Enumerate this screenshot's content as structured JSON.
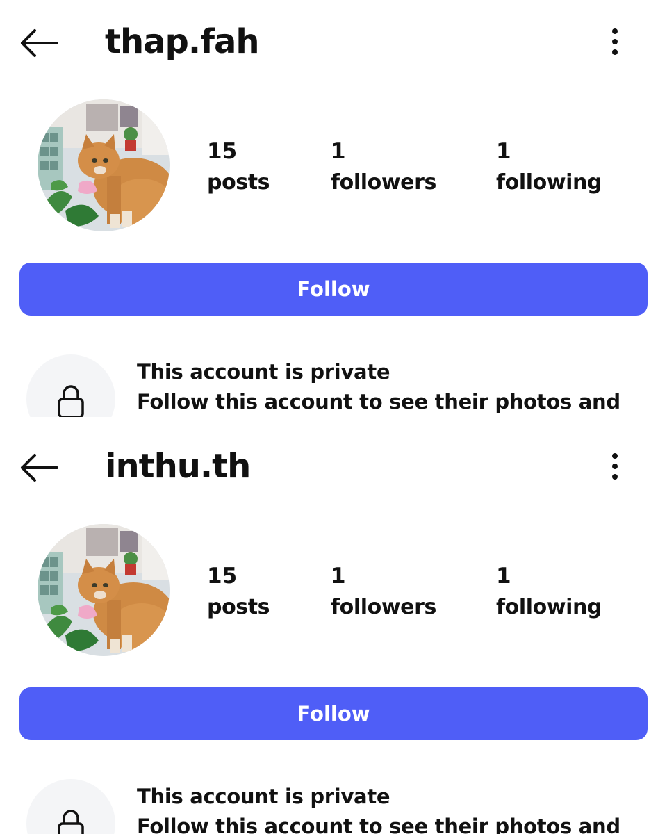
{
  "profiles": [
    {
      "username": "thap.fah",
      "back_icon": "arrow-left-icon",
      "more_icon": "more-vertical-icon",
      "avatar_description_icon": "cat-photo",
      "stats": {
        "posts_count": "15",
        "posts_label": "posts",
        "followers_count": "1",
        "followers_label": "followers",
        "following_count": "1",
        "following_label": "following"
      },
      "follow_label": "Follow",
      "private_title": "This account is private",
      "private_desc": "Follow this account to see their photos and",
      "lock_icon": "lock-icon"
    },
    {
      "username": "inthu.th",
      "back_icon": "arrow-left-icon",
      "more_icon": "more-vertical-icon",
      "avatar_description_icon": "cat-photo",
      "stats": {
        "posts_count": "15",
        "posts_label": "posts",
        "followers_count": "1",
        "followers_label": "followers",
        "following_count": "1",
        "following_label": "following"
      },
      "follow_label": "Follow",
      "private_title": "This account is private",
      "private_desc": "Follow this account to see their photos and",
      "lock_icon": "lock-icon"
    }
  ],
  "colors": {
    "accent": "#4f5ef7",
    "text": "#111111",
    "background": "#ffffff",
    "lock_bg": "#f4f5f7"
  }
}
